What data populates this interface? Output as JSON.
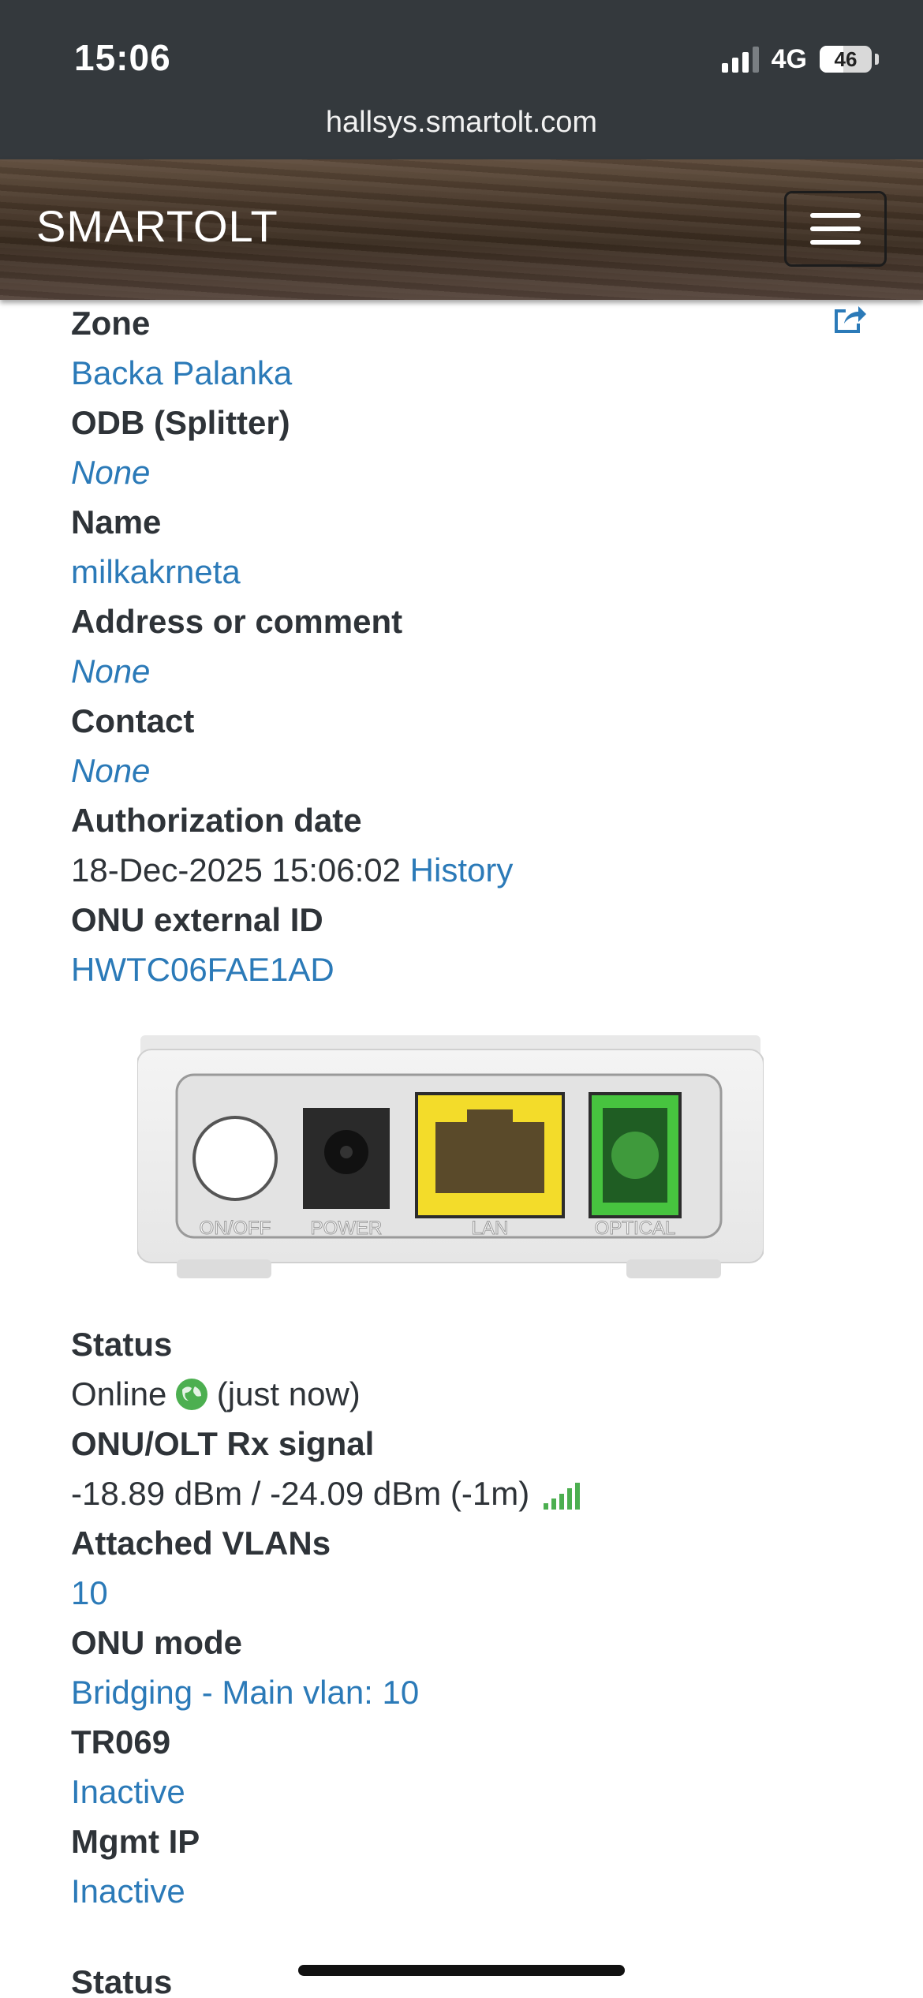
{
  "status_bar": {
    "time": "15:06",
    "network": "4G",
    "battery": "46",
    "battery_level": 0.46
  },
  "url_bar": {
    "url": "hallsys.smartolt.com"
  },
  "navbar": {
    "brand": "SMARTOLT"
  },
  "details": [
    {
      "label": "Zone",
      "value": "Backa Palanka",
      "style": "link"
    },
    {
      "label": "ODB (Splitter)",
      "value": "None",
      "style": "italic"
    },
    {
      "label": "Name",
      "value": "milkakrneta",
      "style": "link"
    },
    {
      "label": "Address or comment",
      "value": "None",
      "style": "italic"
    },
    {
      "label": "Contact",
      "value": "None",
      "style": "italic"
    },
    {
      "label": "Authorization date",
      "value": "18-Dec-2025 15:06:02",
      "link": "History",
      "style": "plain"
    },
    {
      "label": "ONU external ID",
      "value": "HWTC06FAE1AD",
      "style": "link"
    }
  ],
  "device_image": {
    "ports": [
      "ON/OFF",
      "POWER",
      "LAN",
      "OPTICAL"
    ]
  },
  "status_info": [
    {
      "label": "Status",
      "value": "Online",
      "suffix": "(just now)"
    },
    {
      "label": "ONU/OLT Rx signal",
      "value": "-18.89 dBm / -24.09 dBm (-1m)"
    },
    {
      "label": "Attached VLANs",
      "value": "10"
    },
    {
      "label": "ONU mode",
      "value": "Bridging - Main vlan: 10"
    },
    {
      "label": "TR069",
      "value": "Inactive"
    },
    {
      "label": "Mgmt IP",
      "value": "Inactive"
    }
  ],
  "next_section": {
    "label": "Status"
  },
  "colors": {
    "link": "#2b7ab8",
    "label": "#2e3338",
    "online": "#4caf50",
    "chrome": "#34393d"
  }
}
